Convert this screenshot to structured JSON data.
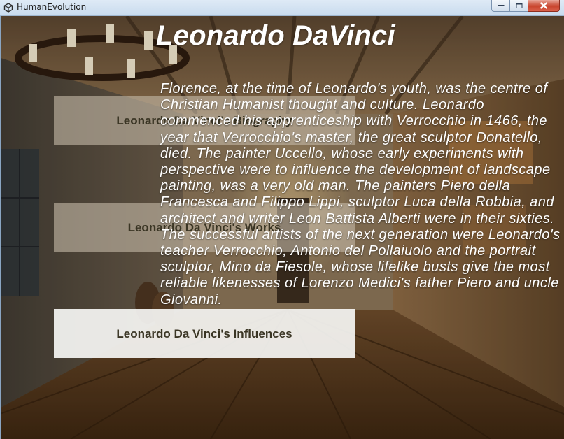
{
  "window": {
    "title": "HumanEvolution",
    "controls": [
      "minimize-icon",
      "maximize-icon",
      "close-icon"
    ]
  },
  "page": {
    "title": "Leonardo DaVinci"
  },
  "nav_buttons": [
    {
      "label": "Leonardo Da Vinci's Biography"
    },
    {
      "label": "Leonardo Da Vinci's Works"
    },
    {
      "label": "Leonardo Da Vinci's Influences"
    }
  ],
  "content": {
    "text": "Florence, at the time of Leonardo's youth, was the centre of Christian Humanist thought and culture. Leonardo commenced his apprenticeship with Verrocchio in 1466, the year that Verrocchio's master, the great sculptor Donatello, died. The painter Uccello, whose early experiments with perspective were to influence the development of landscape painting, was a very old man. The painters Piero della Francesca and Filippo Lippi, sculptor Luca della Robbia, and architect and writer Leon Battista Alberti were in their sixties. The successful artists of the next generation were Leonardo's teacher Verrocchio, Antonio del Pollaiuolo and the portrait sculptor, Mino da Fiesole, whose lifelike busts give the most reliable likenesses of Lorenzo Medici's father Piero and uncle Giovanni."
  },
  "colors": {
    "title_text": "#ffffff",
    "button_text": "#3a3524",
    "button_dark_bg": "#c4b8a6",
    "button_light_bg": "#f6f6f4"
  }
}
